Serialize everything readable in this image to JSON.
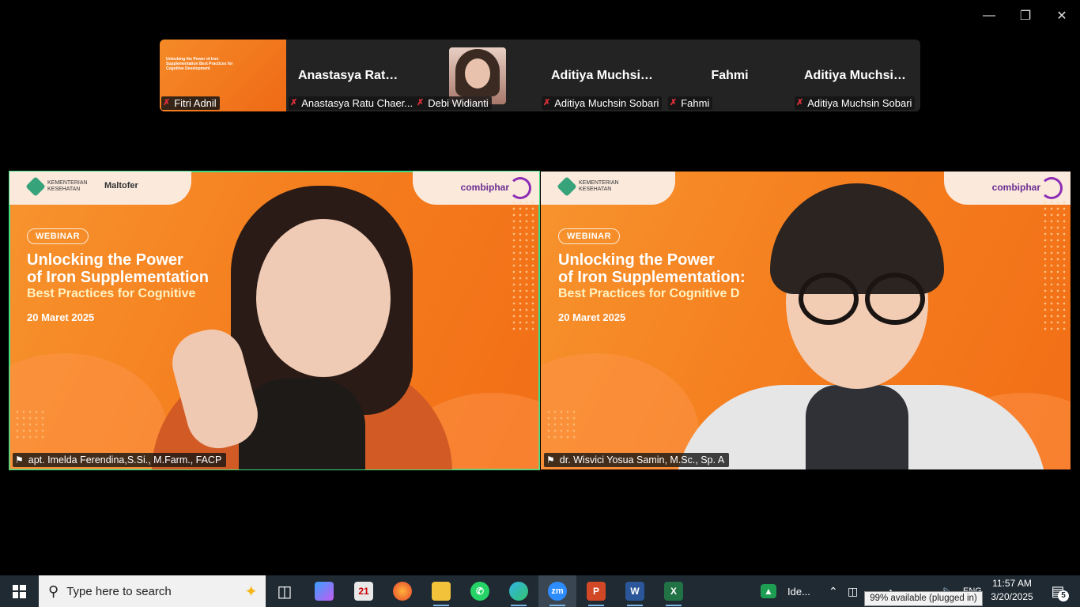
{
  "window": {
    "minimize_icon": "minimize-icon",
    "restore_icon": "restore-icon",
    "close_icon": "close-icon"
  },
  "strip": {
    "participants": [
      {
        "big_name": "",
        "label": "Fitri Adnil",
        "muted": true
      },
      {
        "big_name": "Anastasya Ratu...",
        "label": "Anastasya Ratu Chaer...",
        "muted": true
      },
      {
        "big_name": "",
        "label": "Debi Widianti",
        "muted": true
      },
      {
        "big_name": "Aditiya Muchsin...",
        "label": "Aditiya Muchsin Sobari",
        "muted": true
      },
      {
        "big_name": "Fahmi",
        "label": "Fahmi",
        "muted": true
      },
      {
        "big_name": "Aditiya Muchsin...",
        "label": "Aditiya Muchsin Sobari",
        "muted": true
      }
    ],
    "thumb_slide_text": "Unlocking the Power of Iron Supplementation Best Practices for Cognitive Development"
  },
  "slide": {
    "tag": "WEBINAR",
    "title_line1": "Unlocking the Power",
    "title_line2_left": "of Iron Supplementation",
    "title_line2_right": "of Iron Supplementation:",
    "title_line3_left": "Best Practices for Cognitive",
    "title_line3_right": "Best Practices for Cognitive D",
    "date": "20 Maret 2025",
    "brand": "combiphar",
    "sponsor": "Maltofer"
  },
  "videos": [
    {
      "name": "apt. Imelda Ferendina,S.Si., M.Farm., FACP",
      "active": true
    },
    {
      "name": "dr. Wisvici Yosua Samin, M.Sc., Sp. A",
      "active": false
    }
  ],
  "taskbar": {
    "search_placeholder": "Type here to search",
    "zoom_label": "zm",
    "tray_app_label": "Ide...",
    "language": "ENG",
    "time": "11:57 AM",
    "date": "3/20/2025",
    "battery_tooltip": "99% available (plugged in)",
    "notification_count": "5",
    "word_letter": "W",
    "excel_letter": "X",
    "ppt_letter": "P"
  },
  "colors": {
    "active_speaker_border": "#3fdc83",
    "slide_orange": "#f57f1f",
    "muted_red": "#e0303a",
    "taskbar_bg": "#1f2a33"
  }
}
